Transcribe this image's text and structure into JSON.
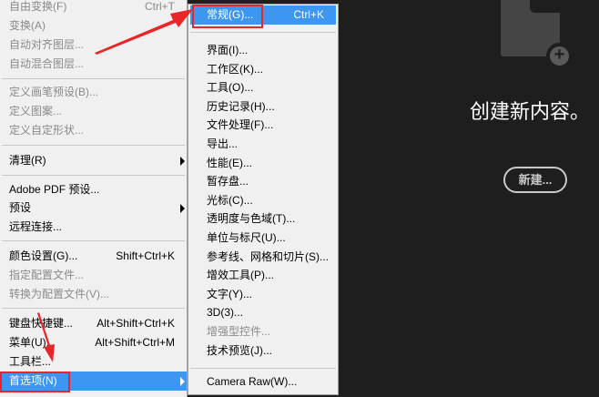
{
  "left_menu": {
    "items": [
      {
        "label": "自由变换(F)",
        "shortcut": "Ctrl+T",
        "disabled": true
      },
      {
        "label": "变换(A)",
        "disabled": true
      },
      {
        "label": "自动对齐图层...",
        "disabled": true
      },
      {
        "label": "自动混合图层...",
        "disabled": true
      },
      {
        "label": "定义画笔预设(B)...",
        "disabled": true
      },
      {
        "label": "定义图案...",
        "disabled": true
      },
      {
        "label": "定义自定形状...",
        "disabled": true
      },
      {
        "label": "清理(R)",
        "submenu": true
      },
      {
        "label": "Adobe PDF 预设..."
      },
      {
        "label": "预设",
        "submenu": true
      },
      {
        "label": "远程连接..."
      },
      {
        "label": "颜色设置(G)...",
        "shortcut": "Shift+Ctrl+K"
      },
      {
        "label": "指定配置文件...",
        "disabled": true
      },
      {
        "label": "转换为配置文件(V)...",
        "disabled": true
      },
      {
        "label": "键盘快捷键...",
        "shortcut": "Alt+Shift+Ctrl+K"
      },
      {
        "label": "菜单(U)...",
        "shortcut": "Alt+Shift+Ctrl+M"
      },
      {
        "label": "工具栏..."
      },
      {
        "label": "首选项(N)",
        "submenu": true,
        "highlighted": true
      }
    ]
  },
  "sub_menu": {
    "items": [
      {
        "label": "常规(G)...",
        "shortcut": "Ctrl+K",
        "highlighted": true
      },
      {
        "label": "界面(I)..."
      },
      {
        "label": "工作区(K)..."
      },
      {
        "label": "工具(O)..."
      },
      {
        "label": "历史记录(H)..."
      },
      {
        "label": "文件处理(F)..."
      },
      {
        "label": "导出..."
      },
      {
        "label": "性能(E)..."
      },
      {
        "label": "暂存盘..."
      },
      {
        "label": "光标(C)..."
      },
      {
        "label": "透明度与色域(T)..."
      },
      {
        "label": "单位与标尺(U)..."
      },
      {
        "label": "参考线、网格和切片(S)..."
      },
      {
        "label": "增效工具(P)..."
      },
      {
        "label": "文字(Y)..."
      },
      {
        "label": "3D(3)..."
      },
      {
        "label": "增强型控件...",
        "disabled": true
      },
      {
        "label": "技术预览(J)..."
      },
      {
        "label": "Camera Raw(W)..."
      }
    ]
  },
  "start": {
    "title": "创建新内容。",
    "new_button": "新建..."
  },
  "colors": {
    "highlight": "#3d97f0",
    "annotation": "#e8262a",
    "background": "#1e1e1e"
  }
}
